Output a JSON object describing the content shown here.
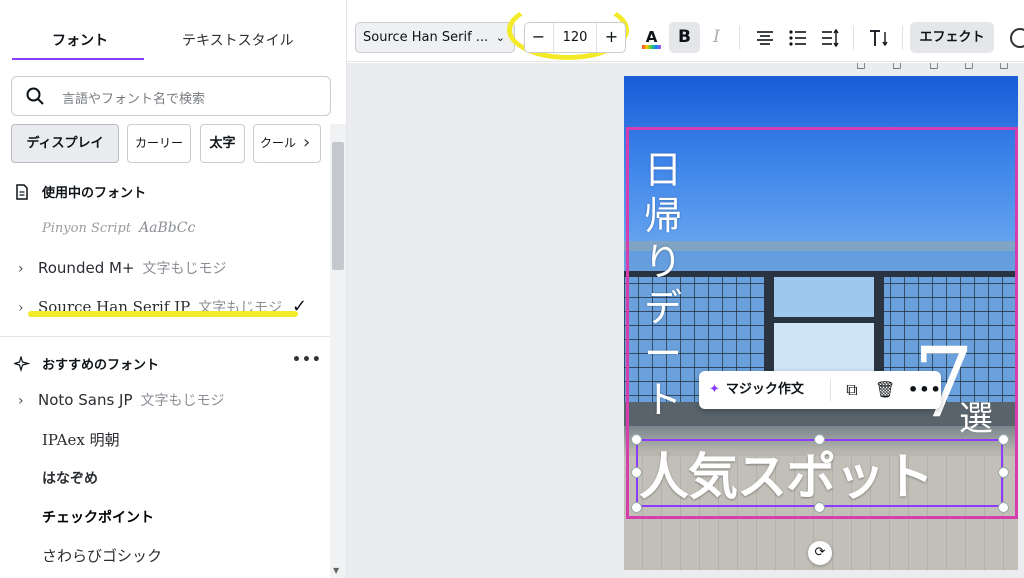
{
  "tabs": {
    "fonts": "フォント",
    "text_styles": "テキストスタイル"
  },
  "search": {
    "placeholder": "言語やフォント名で検索"
  },
  "chips": {
    "display": "ディスプレイ",
    "curly": "カーリー",
    "bold": "太字",
    "cool": "クール"
  },
  "sections": {
    "in_use": "使用中のフォント",
    "recommended": "おすすめのフォント"
  },
  "in_use_fonts": [
    {
      "name": "Pinyon Script",
      "sample": "AaBbCc"
    },
    {
      "name": "Rounded M+",
      "sample": "文字もじモジ"
    },
    {
      "name": "Source Han Serif JP",
      "sample": "文字もじモジ"
    }
  ],
  "recommended_fonts": [
    {
      "name": "Noto Sans JP",
      "sample": "文字もじモジ"
    },
    {
      "name": "IPAex 明朝",
      "sample": ""
    },
    {
      "name": "はなぞめ",
      "sample": ""
    },
    {
      "name": "チェックポイント",
      "sample": ""
    },
    {
      "name": "さわらびゴシック",
      "sample": ""
    }
  ],
  "toolbar": {
    "font_name": "Source Han Serif ...",
    "font_size": "120",
    "minus": "−",
    "plus": "+",
    "color": "A",
    "bold": "B",
    "italic": "I",
    "effects": "エフェクト"
  },
  "canvas": {
    "title_vertical": [
      "日",
      "帰",
      "り",
      "デ",
      "ー",
      "ト"
    ],
    "number": "7",
    "counter": "選",
    "main_title": "人気スポット"
  },
  "context_menu": {
    "magic_write": "マジック作文"
  },
  "colors": {
    "accent": "#8b3dff",
    "highlight": "#f3ea28",
    "frame": "#d63eae"
  }
}
